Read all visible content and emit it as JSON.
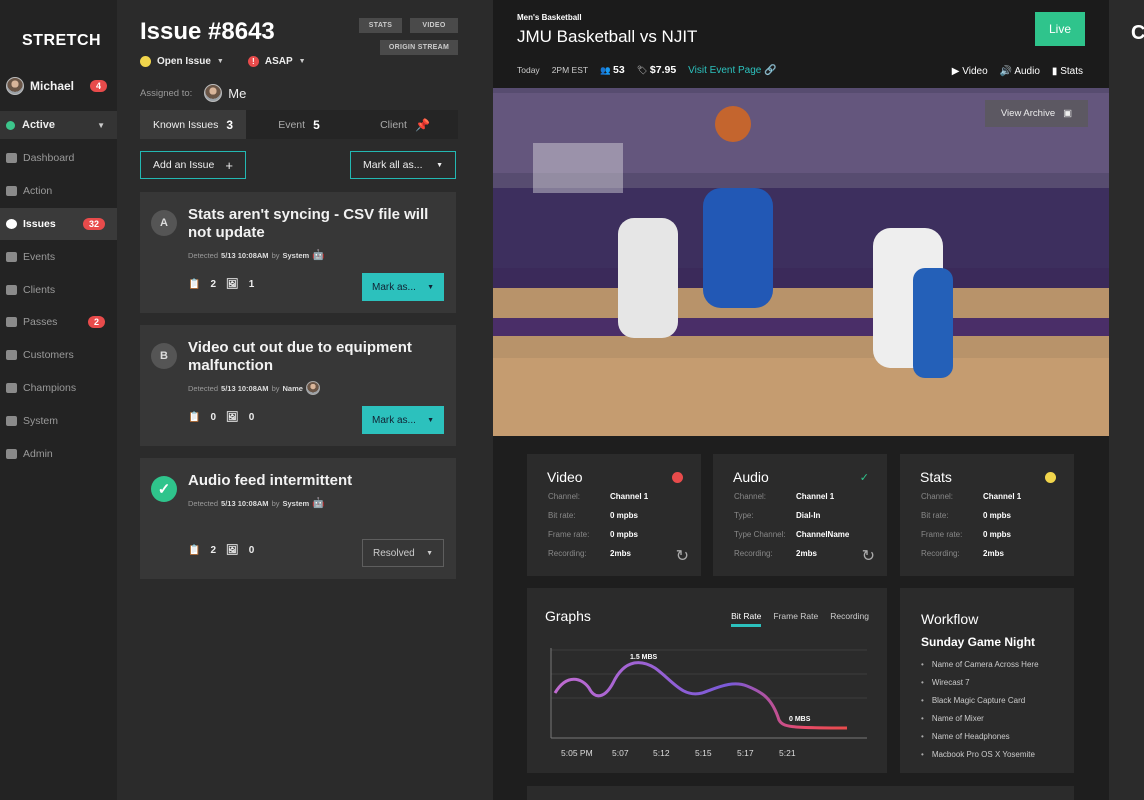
{
  "app": {
    "logo": "STRETCH"
  },
  "user": {
    "name": "Michael",
    "badge": "4"
  },
  "status": {
    "label": "Active"
  },
  "nav": [
    {
      "label": "Dashboard",
      "badge": ""
    },
    {
      "label": "Action",
      "badge": ""
    },
    {
      "label": "Issues",
      "badge": "32"
    },
    {
      "label": "Events",
      "badge": ""
    },
    {
      "label": "Clients",
      "badge": ""
    },
    {
      "label": "Passes",
      "badge": "2"
    },
    {
      "label": "Customers",
      "badge": ""
    },
    {
      "label": "Champions",
      "badge": ""
    },
    {
      "label": "System",
      "badge": ""
    },
    {
      "label": "Admin",
      "badge": ""
    }
  ],
  "issue": {
    "title": "Issue #8643",
    "buttons": {
      "stats": "STATS",
      "video": "VIDEO",
      "origin": "ORIGIN STREAM"
    },
    "status": "Open Issue",
    "priority": "ASAP",
    "assigned_label": "Assigned to:",
    "assigned_to": "Me",
    "tabs": [
      {
        "label": "Known Issues",
        "count": "3"
      },
      {
        "label": "Event",
        "count": "5"
      },
      {
        "label": "Client",
        "count": ""
      }
    ],
    "add_label": "Add an Issue",
    "mark_all_label": "Mark all as...",
    "cards": [
      {
        "letter": "A",
        "title": "Stats aren't syncing - CSV file will not update",
        "detected": "Detected",
        "date": "5/13 10:08AM",
        "by": "by",
        "who": "System",
        "docs": "2",
        "images": "1",
        "action": "Mark as..."
      },
      {
        "letter": "B",
        "title": "Video cut out due to equipment malfunction",
        "detected": "Detected",
        "date": "5/13 10:08AM",
        "by": "by",
        "who": "Name",
        "docs": "0",
        "images": "0",
        "action": "Mark as..."
      },
      {
        "letter": "✓",
        "title": "Audio feed intermittent",
        "detected": "Detected",
        "date": "5/13 10:08AM",
        "by": "by",
        "who": "System",
        "docs": "2",
        "images": "0",
        "action": "Resolved"
      }
    ]
  },
  "event": {
    "subtitle": "Men's Basketball",
    "title": "JMU Basketball vs NJIT",
    "live": "Live",
    "day": "Today",
    "time": "2PM EST",
    "attendees": "53",
    "price": "$7.95",
    "link": "Visit Event Page",
    "tabs": [
      "Video",
      "Audio",
      "Stats"
    ],
    "archive": "View Archive"
  },
  "cards": {
    "video": {
      "title": "Video",
      "indicator_color": "#e84b4b",
      "rows": [
        [
          "Channel:",
          "Channel 1"
        ],
        [
          "Bit rate:",
          "0 mpbs"
        ],
        [
          "Frame rate:",
          "0 mpbs"
        ],
        [
          "Recording:",
          "2mbs"
        ]
      ]
    },
    "audio": {
      "title": "Audio",
      "indicator": "✓",
      "rows": [
        [
          "Channel:",
          "Channel 1"
        ],
        [
          "Type:",
          "Dial-In"
        ],
        [
          "Type Channel:",
          "ChannelName"
        ],
        [
          "Recording:",
          "2mbs"
        ]
      ]
    },
    "stats": {
      "title": "Stats",
      "indicator_color": "#f1d54c",
      "rows": [
        [
          "Channel:",
          "Channel 1"
        ],
        [
          "Bit rate:",
          "0 mpbs"
        ],
        [
          "Frame rate:",
          "0 mpbs"
        ],
        [
          "Recording:",
          "2mbs"
        ]
      ]
    }
  },
  "graphs": {
    "title": "Graphs",
    "tabs": [
      "Bit Rate",
      "Frame Rate",
      "Recording"
    ],
    "x_labels": [
      "5:05 PM",
      "5:07",
      "5:12",
      "5:15",
      "5:17",
      "5:21"
    ],
    "peak_label": "1.5 MBS",
    "zero_label": "0 MBS"
  },
  "workflow": {
    "title": "Workflow",
    "subtitle": "Sunday Game Night",
    "items": [
      "Name of Camera Across Here",
      "Wirecast 7",
      "Black Magic Capture Card",
      "Name of Mixer",
      "Name of Headphones",
      "Macbook Pro OS X Yosemite"
    ]
  },
  "right_panel": {
    "letter": "C"
  }
}
